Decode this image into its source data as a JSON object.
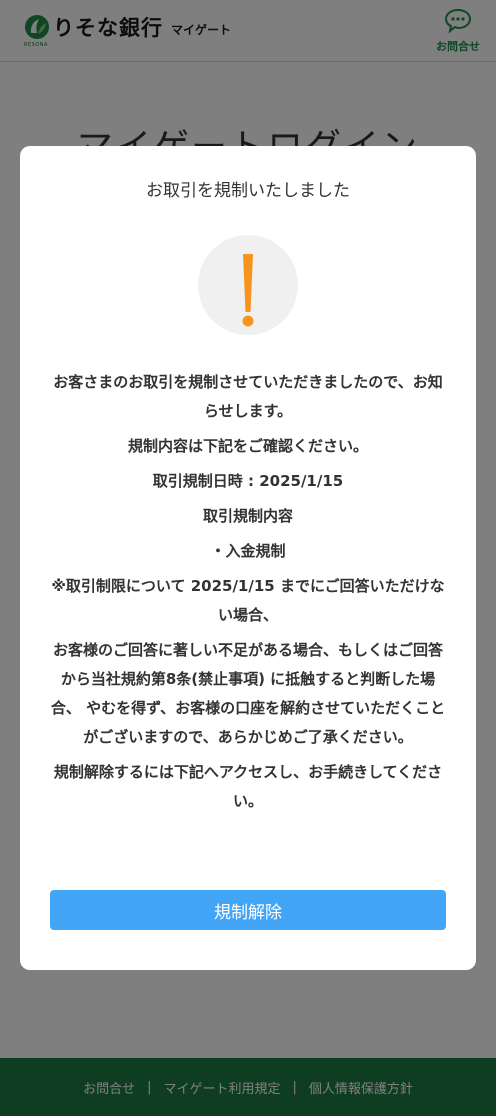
{
  "header": {
    "brand_name": "りそな銀行",
    "brand_sub": "RESONA",
    "service_name": "マイゲート",
    "contact_label": "お問合せ"
  },
  "background": {
    "page_title": "マイゲートログイン"
  },
  "footer": {
    "links": [
      "お問合せ",
      "マイゲート利用規定",
      "個人情報保護方針"
    ],
    "separator": "|"
  },
  "modal": {
    "title": "お取引を規制いたしました",
    "paragraphs": [
      "お客さまのお取引を規制させていただきましたので、お知らせします。",
      "規制内容は下記をご確認ください。",
      "取引規制日時 : 2025/1/15",
      "取引規制内容",
      "・入金規制",
      "※取引制限について 2025/1/15 までにご回答いただけない場合、",
      "お客様のご回答に著しい不足がある場合、もしくはご回答から当社規約第8条(禁止事項) に抵触すると判断した場合、 やむを得ず、お客様の口座を解約させていただくことがございますので、あらかじめご了承ください。",
      "規制解除するには下記へアクセスし、お手続きしてください。"
    ],
    "button_label": "規制解除"
  },
  "colors": {
    "brand_green": "#1f7a43",
    "warning_orange": "#f7941d",
    "button_blue": "#42a5f5"
  },
  "icons": {
    "logo": "resona-logo-icon",
    "contact": "chat-bubble-icon",
    "warning": "exclamation-icon"
  }
}
